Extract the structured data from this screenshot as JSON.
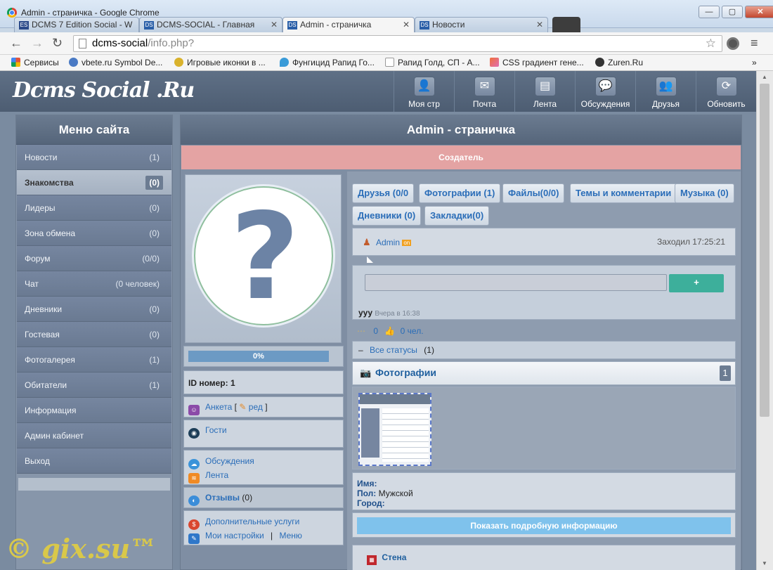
{
  "window": {
    "title": "Admin - страничка - Google Chrome",
    "min": "—",
    "max": "▢",
    "close": "✕"
  },
  "tabs": [
    {
      "label": "DCMS 7 Edition Social - W",
      "icon": "ES"
    },
    {
      "label": "DCMS-SOCIAL - Главная",
      "icon": "DS"
    },
    {
      "label": "Admin - страничка",
      "icon": "DS"
    },
    {
      "label": "Новости",
      "icon": "DS"
    }
  ],
  "address": {
    "host": "dcms-social",
    "path": "/info.php?"
  },
  "bookmarks": [
    {
      "label": "Сервисы",
      "color": "#e0533a"
    },
    {
      "label": "vbete.ru Symbol De...",
      "color": "#4a7ac4"
    },
    {
      "label": "Игровые иконки в ...",
      "color": "#d9b22c"
    },
    {
      "label": "Фунгицид Рапид Го...",
      "color": "#3a9bd8"
    },
    {
      "label": "Рапид Голд, СП - А...",
      "color": "#dddddd"
    },
    {
      "label": "CSS градиент гене...",
      "color": "#e06fb3"
    },
    {
      "label": "Zuren.Ru",
      "color": "#333333"
    }
  ],
  "site": {
    "logo": "Dcms Social .Ru",
    "nav": [
      {
        "label": "Моя стр",
        "icon": "user-icon",
        "glyph": "👤"
      },
      {
        "label": "Почта",
        "icon": "mail-icon",
        "glyph": "✉"
      },
      {
        "label": "Лента",
        "icon": "feed-icon",
        "glyph": "▤"
      },
      {
        "label": "Обсуждения",
        "icon": "chat-icon",
        "glyph": "💬"
      },
      {
        "label": "Друзья",
        "icon": "friends-icon",
        "glyph": "👥"
      },
      {
        "label": "Обновить",
        "icon": "refresh-icon",
        "glyph": "⟳"
      }
    ]
  },
  "menu": {
    "title": "Меню сайта",
    "items": [
      {
        "label": "Новости",
        "count": "(1)"
      },
      {
        "label": "Знакомства",
        "count": "(0)"
      },
      {
        "label": "Лидеры",
        "count": "(0)"
      },
      {
        "label": "Зона обмена",
        "count": "(0)"
      },
      {
        "label": "Форум",
        "count": "(0/0)"
      },
      {
        "label": "Чат",
        "count": "(0 человек)"
      },
      {
        "label": "Дневники",
        "count": "(0)"
      },
      {
        "label": "Гостевая",
        "count": "(0)"
      },
      {
        "label": "Фотогалерея",
        "count": "(1)"
      },
      {
        "label": "Обитатели",
        "count": "(1)"
      },
      {
        "label": "Информация",
        "count": ""
      },
      {
        "label": "Админ кабинет",
        "count": ""
      },
      {
        "label": "Выход",
        "count": ""
      }
    ]
  },
  "watermark": "© gix.su™",
  "page": {
    "title": "Admin - страничка",
    "role": "Создатель",
    "progress": {
      "label": "0%",
      "value": 0
    },
    "id_label": "ID номер: 1",
    "anketa": "Анкета",
    "anketa_open": "[",
    "anketa_edit": "ред",
    "anketa_close": "]",
    "guests": "Гости",
    "discussions": "Обсуждения",
    "feed": "Лента",
    "reviews": "Отзывы",
    "reviews_count": "(0)",
    "extra_services": "Дополнительные услуги",
    "my_settings": "Мои настройки",
    "separator": "|",
    "menu_link": "Меню"
  },
  "profile_tabs": [
    "Друзья (0/0",
    "Фотографии (1)",
    "Файлы(0/0)",
    "Темы и комментарии",
    "Музыка (0)",
    "Дневники (0)",
    "Закладки(0)"
  ],
  "user": {
    "name": "Admin",
    "online_badge": "on",
    "last_visit": "Заходил 17:25:21"
  },
  "status": {
    "placeholder": "",
    "submit": "+",
    "text": "ууу",
    "time": "Вчера в 16:38",
    "comments_count": "0",
    "likes": "0 чел.",
    "all_statuses": "Все статусы",
    "all_statuses_count": "(1)",
    "collapse": "–"
  },
  "photos": {
    "title": "Фотографии",
    "count": "1"
  },
  "info": {
    "name_label": "Имя:",
    "gender_label": "Пол:",
    "gender_value": "Мужской",
    "city_label": "Город:",
    "show_more": "Показать подробную информацию"
  },
  "wall": {
    "title": "Стена"
  }
}
